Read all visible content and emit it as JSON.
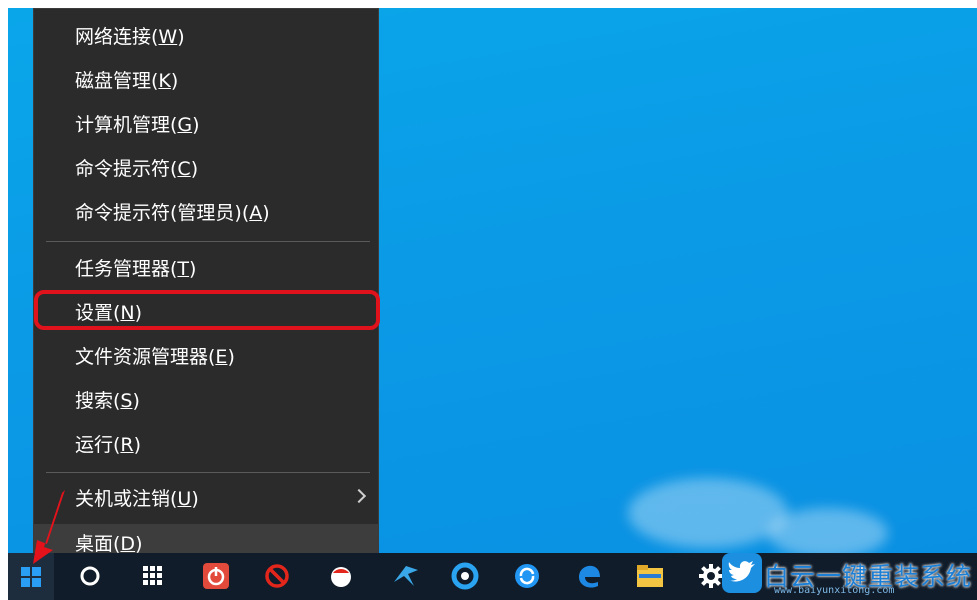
{
  "menu": {
    "items": [
      {
        "text": "网络连接(",
        "key": "W",
        "close": ")"
      },
      {
        "text": "磁盘管理(",
        "key": "K",
        "close": ")"
      },
      {
        "text": "计算机管理(",
        "key": "G",
        "close": ")"
      },
      {
        "text": "命令提示符(",
        "key": "C",
        "close": ")"
      },
      {
        "text": "命令提示符(管理员)(",
        "key": "A",
        "close": ")"
      },
      {
        "text": "任务管理器(",
        "key": "T",
        "close": ")"
      },
      {
        "text": "设置(",
        "key": "N",
        "close": ")"
      },
      {
        "text": "文件资源管理器(",
        "key": "E",
        "close": ")"
      },
      {
        "text": "搜索(",
        "key": "S",
        "close": ")"
      },
      {
        "text": "运行(",
        "key": "R",
        "close": ")"
      },
      {
        "text": "关机或注销(",
        "key": "U",
        "close": ")"
      },
      {
        "text": "桌面(",
        "key": "D",
        "close": ")"
      }
    ],
    "highlight_color": "#e0121b"
  },
  "taskbar": {
    "icons": [
      "windows-start-icon",
      "cortana-icon",
      "calculator-icon",
      "power-app-icon",
      "block-app-icon",
      "red-app-icon",
      "bird-app-icon",
      "circle-app-icon",
      "sync-app-icon",
      "edge-icon",
      "file-explorer-icon",
      "settings-gear-icon"
    ]
  },
  "watermark": {
    "text": "白云一键重装系统",
    "url": "www.baiyunxitong.com"
  }
}
